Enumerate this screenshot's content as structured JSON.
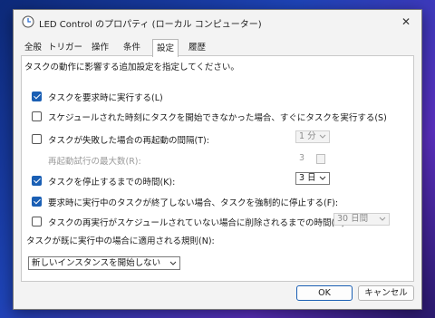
{
  "window": {
    "title": "LED Control のプロパティ (ローカル コンピューター)",
    "close_glyph": "✕"
  },
  "tabs": [
    {
      "label": "全般"
    },
    {
      "label": "トリガー"
    },
    {
      "label": "操作"
    },
    {
      "label": "条件"
    },
    {
      "label": "設定"
    },
    {
      "label": "履歴"
    }
  ],
  "active_tab": "設定",
  "settings": {
    "intro": "タスクの動作に影響する追加設定を指定してください。",
    "run_on_demand": {
      "label": "タスクを要求時に実行する(L)",
      "checked": true
    },
    "run_after_missed": {
      "label": "スケジュールされた時刻にタスクを開始できなかった場合、すぐにタスクを実行する(S)",
      "checked": false
    },
    "restart_on_fail": {
      "label": "タスクが失敗した場合の再起動の間隔(T):",
      "checked": false,
      "interval": "1 分"
    },
    "restart_attempts": {
      "label": "再起動試行の最大数(R):",
      "value": "3"
    },
    "stop_if_runs_longer": {
      "label": "タスクを停止するまでの時間(K):",
      "checked": true,
      "value": "3 日"
    },
    "force_stop": {
      "label": "要求時に実行中のタスクが終了しない場合、タスクを強制的に停止する(F):",
      "checked": true
    },
    "delete_if_not_scheduled": {
      "label": "タスクの再実行がスケジュールされていない場合に削除されるまでの時間(D):",
      "checked": false,
      "value": "30 日間"
    },
    "rule_label": "タスクが既に実行中の場合に適用される規則(N):",
    "rule_value": "新しいインスタンスを開始しない"
  },
  "buttons": {
    "ok": "OK",
    "cancel": "キャンセル"
  },
  "colors": {
    "accent": "#1a5fb4"
  }
}
